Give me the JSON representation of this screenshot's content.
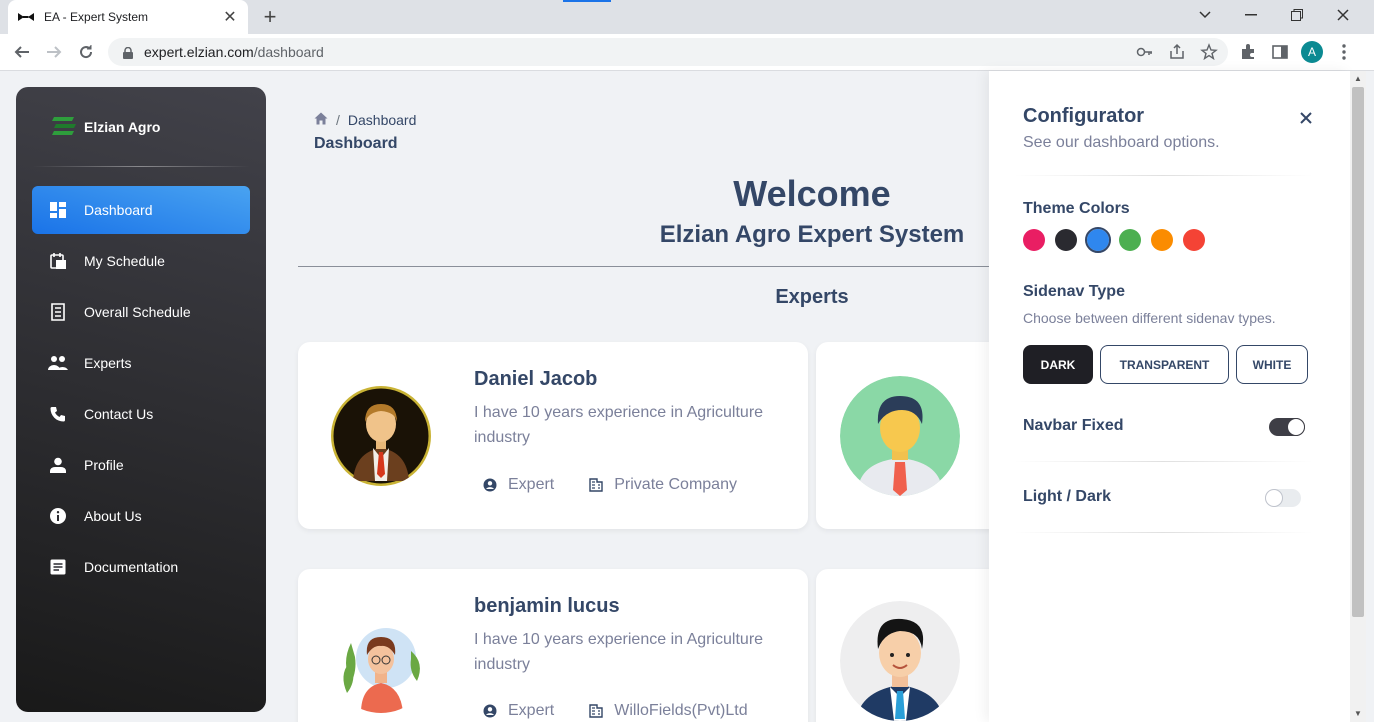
{
  "browser": {
    "tab_title": "EA - Expert System",
    "url_host": "expert.elzian.com",
    "url_path": "/dashboard",
    "profile_initial": "A"
  },
  "sidenav": {
    "brand": "Elzian Agro",
    "items": [
      {
        "label": "Dashboard",
        "icon": "dashboard-icon",
        "active": true
      },
      {
        "label": "My Schedule",
        "icon": "calendar-icon"
      },
      {
        "label": "Overall Schedule",
        "icon": "receipt-icon"
      },
      {
        "label": "Experts",
        "icon": "people-icon"
      },
      {
        "label": "Contact Us",
        "icon": "phone-icon"
      },
      {
        "label": "Profile",
        "icon": "person-icon"
      },
      {
        "label": "About Us",
        "icon": "info-icon"
      },
      {
        "label": "Documentation",
        "icon": "document-icon"
      }
    ]
  },
  "main": {
    "breadcrumb_current": "Dashboard",
    "page_title": "Dashboard",
    "welcome": "Welcome",
    "welcome_sub": "Elzian Agro Expert System",
    "experts_heading": "Experts",
    "experts": [
      {
        "name": "Daniel Jacob",
        "bio": "I have 10 years experience in Agriculture industry",
        "role": "Expert",
        "company": "Private Company"
      },
      {
        "name": "benjamin lucus",
        "bio": "I have 10 years experience in Agriculture industry",
        "role": "Expert",
        "company": "WilloFields(Pvt)Ltd"
      }
    ]
  },
  "configurator": {
    "title": "Configurator",
    "subtitle": "See our dashboard options.",
    "theme_colors_label": "Theme Colors",
    "theme_colors": [
      "#e91e63",
      "#344767",
      "#1a73e8",
      "#4caf50",
      "#fb8c00",
      "#f44335"
    ],
    "selected_color": "#1a73e8",
    "sidenav_type_label": "Sidenav Type",
    "sidenav_type_hint": "Choose between different sidenav types.",
    "sidenav_types": [
      "DARK",
      "TRANSPARENT",
      "WHITE"
    ],
    "navbar_fixed_label": "Navbar Fixed",
    "navbar_fixed": true,
    "light_dark_label": "Light / Dark",
    "dark_mode": false
  }
}
